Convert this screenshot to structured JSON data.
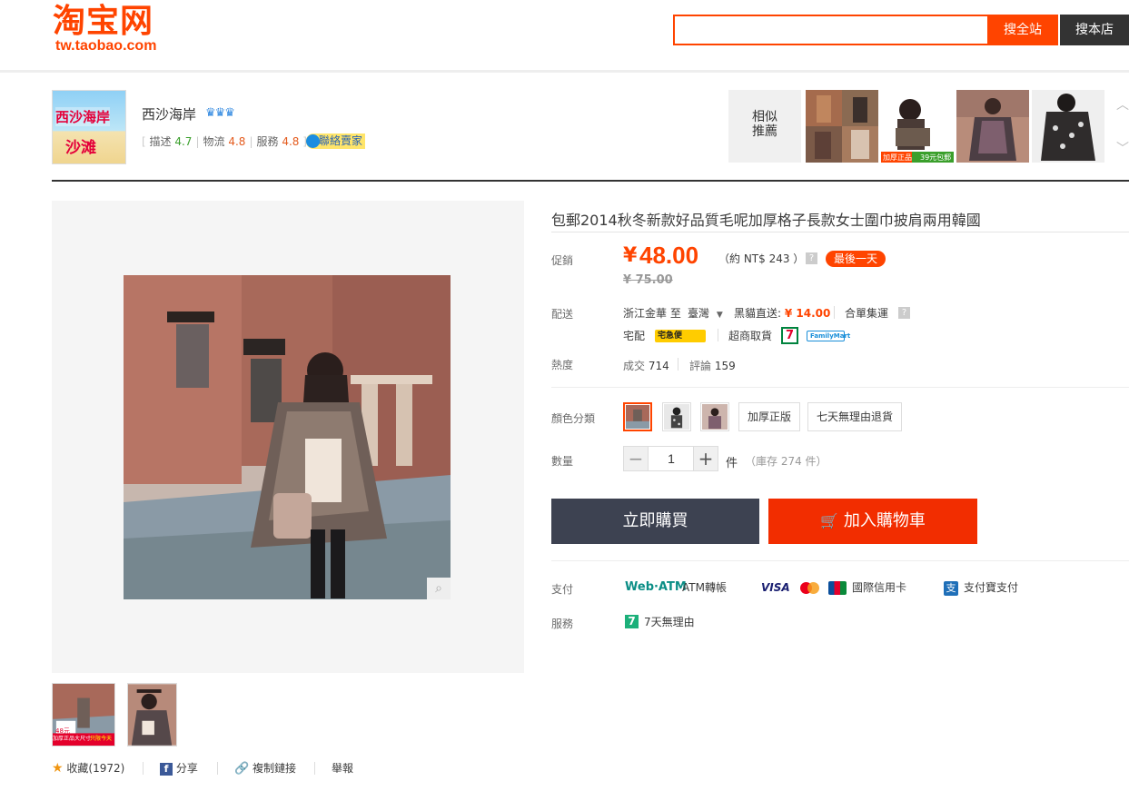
{
  "header": {
    "logo_main": "淘宝网",
    "logo_sub": "tw.taobao.com",
    "search_value": "",
    "search_all_label": "搜全站",
    "search_shop_label": "搜本店"
  },
  "shop": {
    "logo_text_1": "西沙海岸",
    "logo_text_2": "沙滩",
    "name": "西沙海岸",
    "crowns": "♛♛♛",
    "scores": [
      {
        "label": "描述",
        "value": "4.7"
      },
      {
        "label": "物流",
        "value": "4.8"
      },
      {
        "label": "服務",
        "value": "4.8"
      }
    ],
    "contact_label": "聯絡賣家",
    "recommend_label_1": "相似",
    "recommend_label_2": "推薦",
    "rec_badge_1": "加厚正品",
    "rec_badge_2": "39元包郵"
  },
  "gallery": {
    "thumb_badge_1": "加厚正品大尺寸",
    "thumb_badge_2": "只限今天",
    "thumb_price": "48元"
  },
  "social": {
    "favorite": "收藏(1972)",
    "share": "分享",
    "copy_link": "複制鏈接",
    "report": "舉報"
  },
  "product": {
    "title": "包郵2014秋冬新款好品質毛呢加厚格子長款女士圍巾披肩兩用韓國",
    "promo_label": "促銷",
    "currency": "¥",
    "price": "48.00",
    "approx": "（約 NT$ 243 ）",
    "help_mark": "?",
    "last_day_badge": "最後一天",
    "original_price": "¥ 75.00",
    "delivery_label": "配送",
    "ship_from": "浙江金華 至",
    "ship_to": "臺灣",
    "direct_label": "黑貓直送:",
    "direct_price": "¥ 14.00",
    "consolidate": "合單集運",
    "home_delivery": "宅配",
    "takkyubin": "宅急便",
    "store_pickup": "超商取貨",
    "seven": "7",
    "familymart": "FamilyMart",
    "heat_label": "熱度",
    "sold_label": "成交",
    "sold_count": "714",
    "review_label": "評論",
    "review_count": "159",
    "color_label": "顏色分類",
    "sku_text_1": "加厚正版",
    "sku_text_2": "七天無理由退貨",
    "qty_label": "數量",
    "qty_minus": "−",
    "qty_value": "1",
    "qty_plus": "+",
    "qty_unit": "件",
    "stock": "（庫存 274 件）",
    "buy_now": "立即購買",
    "add_cart": "加入購物車",
    "pay_label": "支付",
    "webatm_logo": "Web·ATM",
    "atm": "ATM轉帳",
    "visa": "VISA",
    "intl_card": "國際信用卡",
    "alipay": "支付寶支付",
    "service_label": "服務",
    "seven_day_icon": "7",
    "seven_day": "7天無理由"
  }
}
